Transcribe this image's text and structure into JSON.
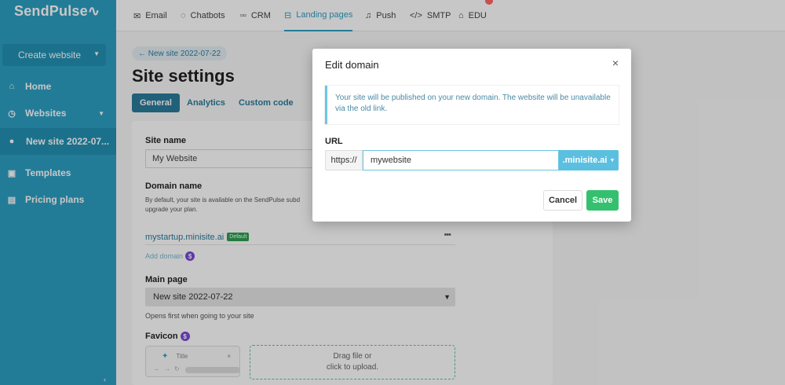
{
  "app": {
    "logo": "SendPulse"
  },
  "sidebar": {
    "create_button": "Create website",
    "items": [
      {
        "label": "Home",
        "icon": "home-icon"
      },
      {
        "label": "Websites",
        "icon": "globe-icon"
      },
      {
        "label": "New site 2022-07...",
        "icon": "dot-icon"
      },
      {
        "label": "Templates",
        "icon": "templates-icon"
      },
      {
        "label": "Pricing plans",
        "icon": "pricing-icon"
      }
    ]
  },
  "topnav": {
    "tabs": [
      {
        "label": "Email",
        "icon": "mail-icon"
      },
      {
        "label": "Chatbots",
        "icon": "chat-icon"
      },
      {
        "label": "CRM",
        "icon": "crm-icon"
      },
      {
        "label": "Landing pages",
        "icon": "landing-icon"
      },
      {
        "label": "Push",
        "icon": "bell-icon"
      },
      {
        "label": "SMTP",
        "icon": "code-icon"
      },
      {
        "label": "EDU",
        "icon": "graduation-cap-icon"
      }
    ],
    "active": "Landing pages"
  },
  "page": {
    "back_link": "← New site 2022-07-22",
    "title": "Site settings",
    "tabs": [
      "General",
      "Analytics",
      "Custom code"
    ],
    "active_tab": "General",
    "site_name_label": "Site name",
    "site_name_value": "My Website",
    "domain_label": "Domain name",
    "domain_hint_1": "By default, your site is available on the SendPulse subd",
    "domain_hint_2": "upgrade your plan.",
    "domain_value": "mystartup.minisite.ai",
    "default_badge": "Default",
    "dots": "•••",
    "add_domain": "Add domain",
    "money_symbol": "$",
    "main_page_label": "Main page",
    "main_page_value": "New site 2022-07-22",
    "main_page_hint": "Opens first when going to your site",
    "favicon_label": "Favicon",
    "favicon_tab_title": "Title",
    "favicon_close": "×",
    "upload_line_1": "Drag file or",
    "upload_line_2": "click to upload."
  },
  "modal": {
    "title": "Edit domain",
    "close": "×",
    "notice": "Your site will be published on your new domain. The website will be unavailable via the old link.",
    "url_label": "URL",
    "prefix": "https://",
    "input_value": "mywebsite",
    "suffix": ".minisite.ai",
    "cancel": "Cancel",
    "save": "Save"
  },
  "colors": {
    "sidebar": "#2d9fc2",
    "accent": "#2b7b9c",
    "save": "#34c06f",
    "suffix": "#5bc0e0"
  }
}
